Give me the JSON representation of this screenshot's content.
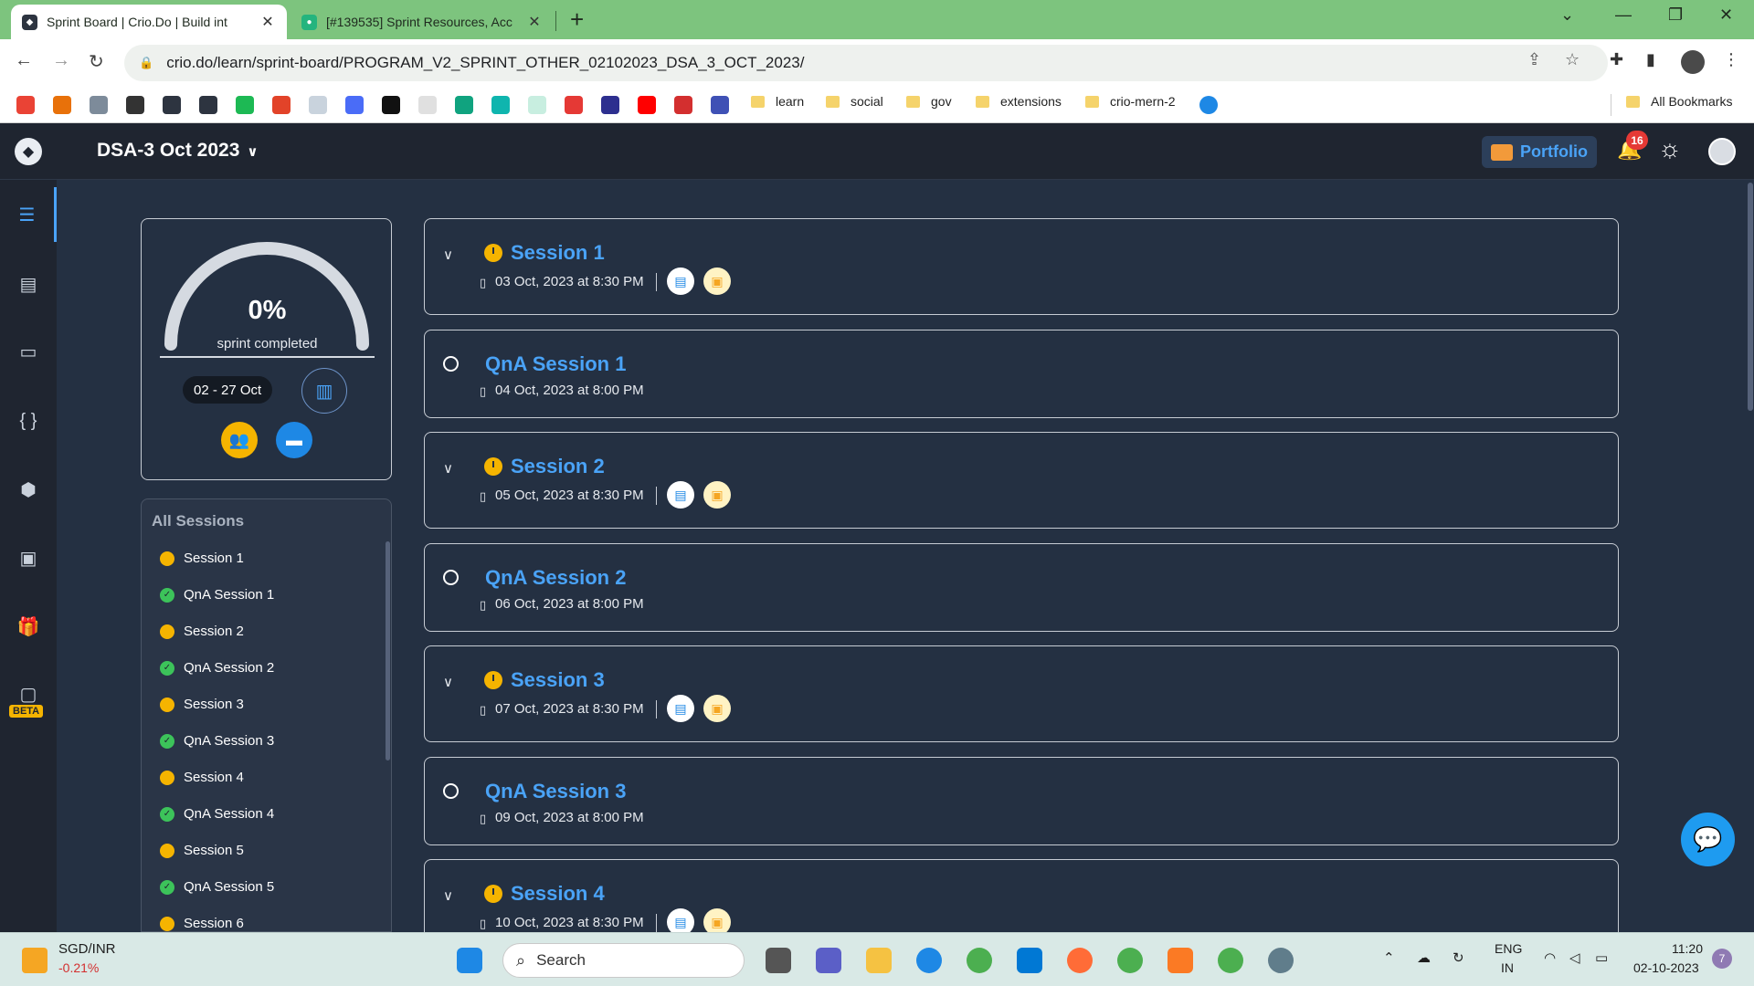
{
  "browser": {
    "tabs": [
      {
        "title": "Sprint Board | Crio.Do | Build int",
        "active": true
      },
      {
        "title": "[#139535] Sprint Resources, Acc",
        "active": false
      }
    ],
    "url": "crio.do/learn/sprint-board/PROGRAM_V2_SPRINT_OTHER_02102023_DSA_3_OCT_2023/",
    "bookmark_folders": [
      "learn",
      "social",
      "gov",
      "extensions",
      "crio-mern-2"
    ],
    "all_bookmarks_label": "All Bookmarks"
  },
  "header": {
    "program_title": "DSA-3 Oct 2023",
    "portfolio_label": "Portfolio",
    "notification_count": "16"
  },
  "rail": {
    "beta_label": "BETA"
  },
  "progress": {
    "percent_text": "0%",
    "percent_value": 0,
    "caption": "sprint completed",
    "date_range": "02 - 27 Oct"
  },
  "all_sessions": {
    "title": "All Sessions",
    "items": [
      {
        "label": "Session 1",
        "status": "pending"
      },
      {
        "label": "QnA Session 1",
        "status": "done"
      },
      {
        "label": "Session 2",
        "status": "pending"
      },
      {
        "label": "QnA Session 2",
        "status": "done"
      },
      {
        "label": "Session 3",
        "status": "pending"
      },
      {
        "label": "QnA Session 3",
        "status": "done"
      },
      {
        "label": "Session 4",
        "status": "pending"
      },
      {
        "label": "QnA Session 4",
        "status": "done"
      },
      {
        "label": "Session 5",
        "status": "pending"
      },
      {
        "label": "QnA Session 5",
        "status": "done"
      },
      {
        "label": "Session 6",
        "status": "pending"
      }
    ]
  },
  "sessions": [
    {
      "title": "Session 1",
      "when": "03 Oct, 2023 at 8:30 PM",
      "kind": "session"
    },
    {
      "title": "QnA Session 1",
      "when": "04 Oct, 2023 at 8:00 PM",
      "kind": "qna"
    },
    {
      "title": "Session 2",
      "when": "05 Oct, 2023 at 8:30 PM",
      "kind": "session"
    },
    {
      "title": "QnA Session 2",
      "when": "06 Oct, 2023 at 8:00 PM",
      "kind": "qna"
    },
    {
      "title": "Session 3",
      "when": "07 Oct, 2023 at 8:30 PM",
      "kind": "session"
    },
    {
      "title": "QnA Session 3",
      "when": "09 Oct, 2023 at 8:00 PM",
      "kind": "qna"
    },
    {
      "title": "Session 4",
      "when": "10 Oct, 2023 at 8:30 PM",
      "kind": "session"
    }
  ],
  "taskbar": {
    "ticker_name": "SGD/INR",
    "ticker_change": "-0.21%",
    "search_placeholder": "Search",
    "language_line1": "ENG",
    "language_line2": "IN",
    "time": "11:20",
    "date": "02-10-2023",
    "notification_count": "7"
  },
  "colors": {
    "accent": "#4aa3f7",
    "pending": "#f5b400",
    "done": "#3cc35a",
    "background": "#243042",
    "header": "#1f2530"
  }
}
